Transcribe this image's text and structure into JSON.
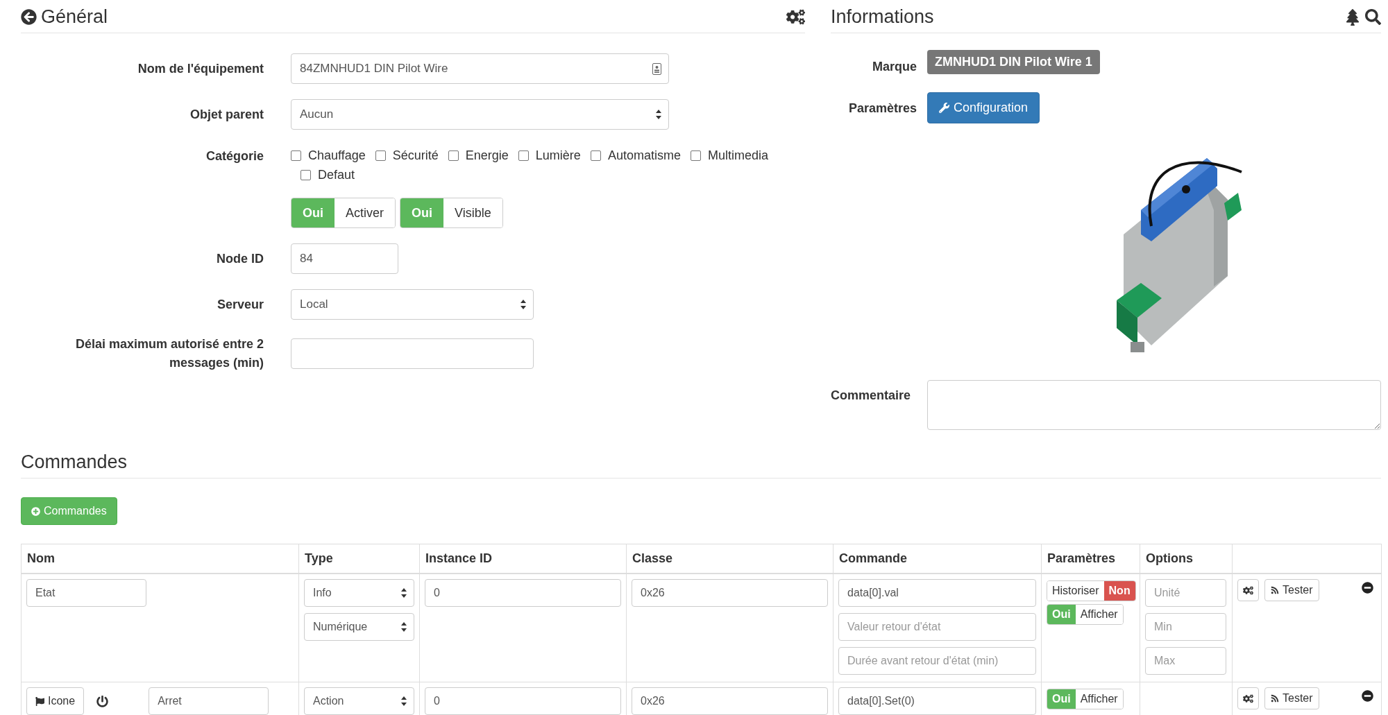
{
  "general": {
    "title": "Général",
    "fields": [
      {
        "kind": "text",
        "label": "Nom de l'équipement",
        "value": "84ZMNHUD1 DIN Pilot Wire"
      },
      {
        "kind": "select",
        "label": "Objet parent",
        "value": "Aucun"
      },
      {
        "kind": "checkboxes",
        "label": "Catégorie",
        "options": [
          {
            "label": "Chauffage",
            "checked": false
          },
          {
            "label": "Sécurité",
            "checked": false
          },
          {
            "label": "Energie",
            "checked": false
          },
          {
            "label": "Lumière",
            "checked": false
          },
          {
            "label": "Automatisme",
            "checked": false
          },
          {
            "label": "Multimedia",
            "checked": false
          },
          {
            "label": "Defaut",
            "checked": false
          }
        ]
      },
      {
        "kind": "toggles",
        "groups": [
          {
            "segments": [
              {
                "kind": "yes",
                "text": "Oui"
              },
              {
                "kind": "label",
                "text": "Activer"
              }
            ]
          },
          {
            "segments": [
              {
                "kind": "yes",
                "text": "Oui"
              },
              {
                "kind": "label",
                "text": "Visible"
              }
            ]
          }
        ]
      },
      {
        "kind": "text",
        "label": "Node ID",
        "value": "84"
      },
      {
        "kind": "select",
        "label": "Serveur",
        "value": "Local"
      },
      {
        "kind": "text",
        "label": "Délai maximum autorisé entre 2 messages (min)"
      }
    ]
  },
  "informations": {
    "title": "Informations",
    "brand_label": "Marque",
    "brand": "ZMNHUD1 DIN Pilot Wire 1",
    "params_label": "Paramètres",
    "config_button": "Configuration",
    "comment_label": "Commentaire"
  },
  "commands": {
    "title": "Commandes",
    "add_button": "Commandes",
    "columns": [
      "Nom",
      "Type",
      "Instance ID",
      "Classe",
      "Commande",
      "Paramètres",
      "Options"
    ],
    "rows": [
      {
        "kind": "info",
        "name": "Etat",
        "types": [
          "Info",
          "Numérique"
        ],
        "instance": "0",
        "classe": "0x26",
        "commande": [
          {
            "value": "data[0].val"
          },
          {
            "placeholder": "Valeur retour d'état"
          },
          {
            "placeholder": "Durée avant retour d'état (min)"
          }
        ],
        "params": [
          {
            "segments": [
              {
                "kind": "label",
                "text": "Historiser"
              },
              {
                "kind": "no",
                "text": "Non"
              }
            ]
          },
          {
            "segments": [
              {
                "kind": "yes",
                "text": "Oui"
              },
              {
                "kind": "label",
                "text": "Afficher"
              }
            ]
          }
        ],
        "options": [
          {
            "placeholder": "Unité"
          },
          {
            "placeholder": "Min"
          },
          {
            "placeholder": "Max"
          }
        ],
        "test_button": "Tester"
      },
      {
        "kind": "action",
        "icon_button": "Icone",
        "name": "Arret",
        "types": [
          "Action"
        ],
        "instance": "0",
        "classe": "0x26",
        "commande": [
          {
            "value": "data[0].Set(0)"
          }
        ],
        "params": [
          {
            "segments": [
              {
                "kind": "yes",
                "text": "Oui"
              },
              {
                "kind": "label",
                "text": "Afficher"
              }
            ]
          }
        ],
        "test_button": "Tester"
      }
    ]
  }
}
